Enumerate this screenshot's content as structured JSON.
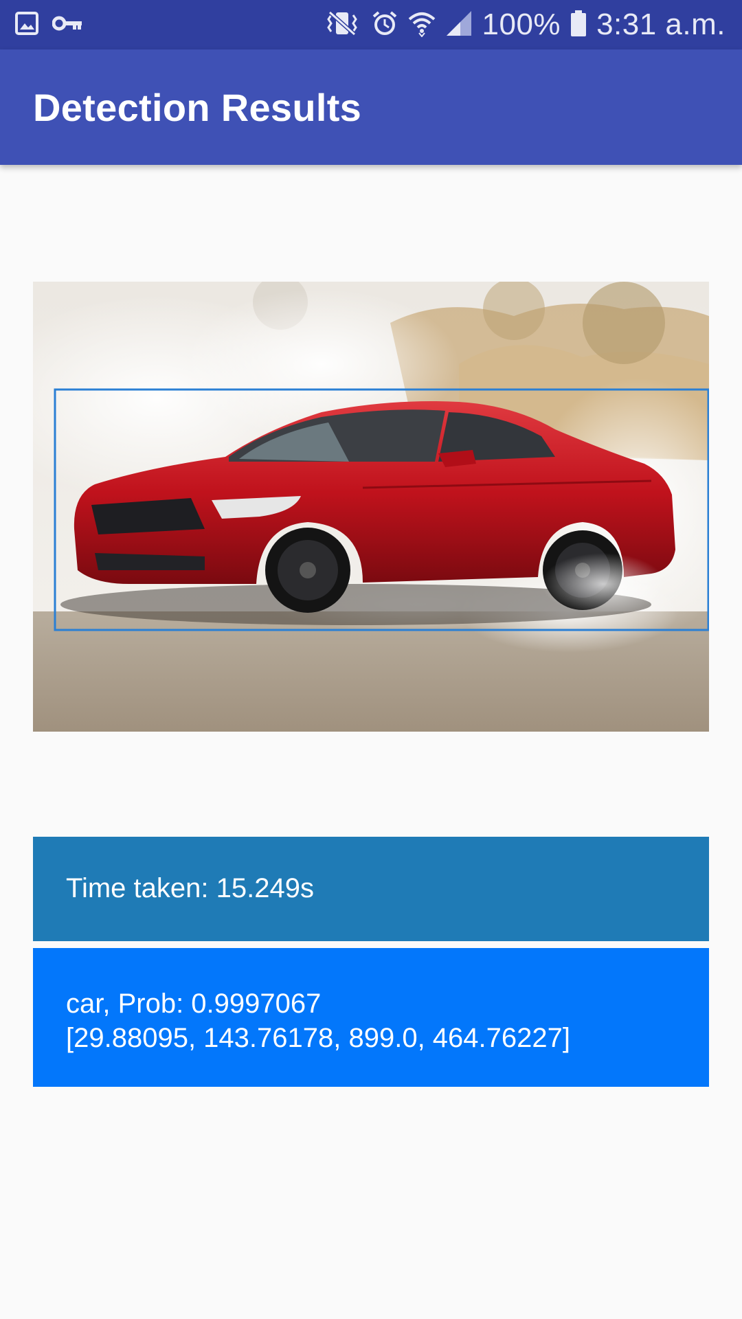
{
  "status_bar": {
    "left_icons": [
      "image-icon",
      "key-icon"
    ],
    "right_icons": [
      "vibrate-icon",
      "alarm-icon",
      "wifi-icon",
      "cell-signal-icon",
      "battery-icon"
    ],
    "battery": "100%",
    "time": "3:31 a.m.",
    "bar_color": "#303f9f"
  },
  "app_bar": {
    "title": "Detection Results",
    "color": "#3f51b5"
  },
  "image": {
    "subject": "red-sports-car-photo",
    "detection_box_color": "#2a7fd4"
  },
  "results": {
    "time_taken": "Time taken: 15.249s",
    "time_box_color": "#1f7bb6",
    "detection_label": "car, Prob: 0.9997067",
    "detection_bbox": "[29.88095, 143.76178, 899.0, 464.76227]",
    "detection_box_color": "#0377fb"
  }
}
